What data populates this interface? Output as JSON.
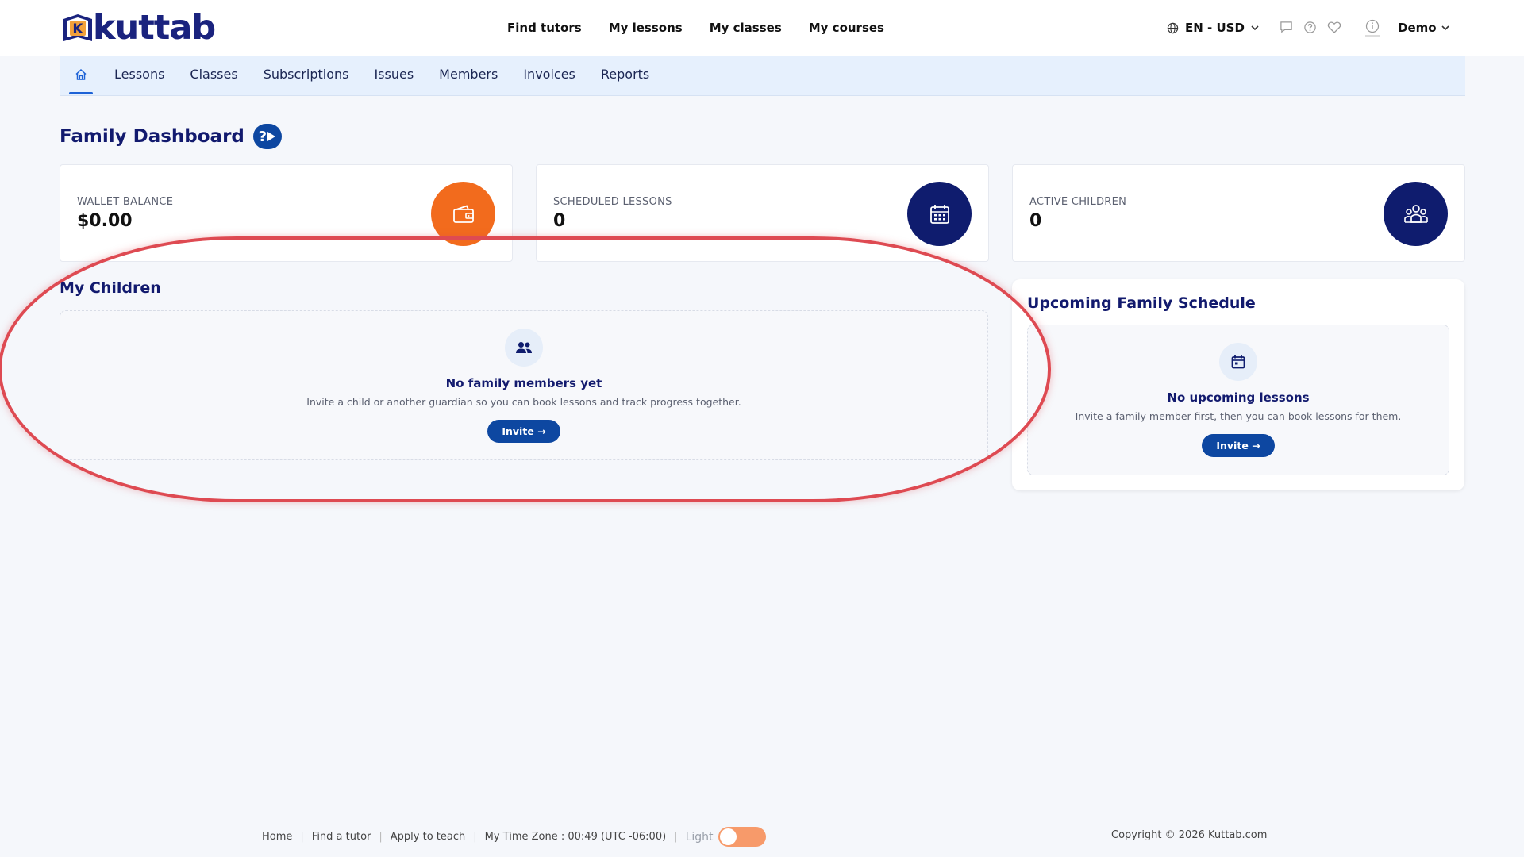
{
  "brand": {
    "name": "kuttab",
    "logo_letter": "K"
  },
  "mainnav": [
    "Find tutors",
    "My lessons",
    "My classes",
    "My courses"
  ],
  "header": {
    "language": "EN - USD",
    "user": "Demo"
  },
  "subnav": [
    "Lessons",
    "Classes",
    "Subscriptions",
    "Issues",
    "Members",
    "Invoices",
    "Reports"
  ],
  "page": {
    "title": "Family Dashboard",
    "help_glyph": "?"
  },
  "stats": [
    {
      "label": "WALLET BALANCE",
      "value": "$0.00",
      "icon": "wallet-icon",
      "color": "#f26b1d"
    },
    {
      "label": "SCHEDULED LESSONS",
      "value": "0",
      "icon": "calendar-icon",
      "color": "#0f1c6e"
    },
    {
      "label": "ACTIVE CHILDREN",
      "value": "0",
      "icon": "family-icon",
      "color": "#0f1c6e"
    }
  ],
  "children": {
    "title": "My Children",
    "empty_title": "No family members yet",
    "empty_sub": "Invite a child or another guardian so you can book lessons and track progress together.",
    "button": "Invite →"
  },
  "schedule": {
    "title": "Upcoming Family Schedule",
    "empty_title": "No upcoming lessons",
    "empty_sub": "Invite a family member first, then you can book lessons for them.",
    "button": "Invite →"
  },
  "footer": {
    "links": [
      "Home",
      "Find a tutor",
      "Apply to teach"
    ],
    "timezone": "My Time Zone : 00:49 (UTC -06:00)",
    "theme_label": "Light",
    "copyright": "Copyright © 2026 Kuttab.com"
  },
  "colors": {
    "accent": "#0d47a1",
    "brand": "#1a237e",
    "orange": "#f26b1d",
    "highlight": "#de4a52"
  }
}
